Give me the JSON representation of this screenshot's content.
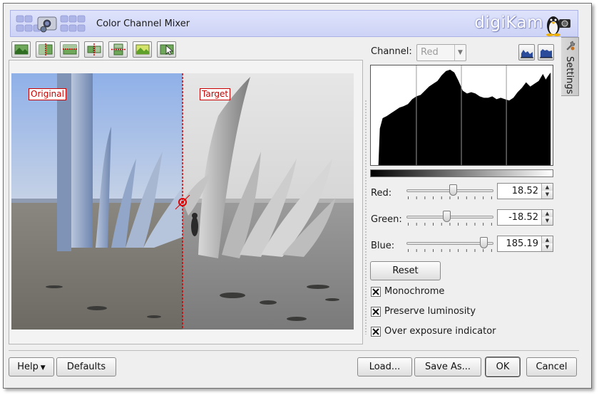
{
  "window": {
    "title": "Color Channel Mixer",
    "brand": "digiKam"
  },
  "toolbar": {
    "buttons": [
      "original-image-icon",
      "split-vertical-icon",
      "split-horizontal-icon",
      "separate-vertical-icon",
      "separate-horizontal-icon",
      "target-image-icon",
      "under-cursor-icon"
    ]
  },
  "preview": {
    "original_label": "Original",
    "target_label": "Target"
  },
  "channel": {
    "label": "Channel:",
    "selected": "Red"
  },
  "settings_tab": "Settings",
  "mixer": {
    "red": {
      "label": "Red:",
      "value": "18.52",
      "level": 0.54
    },
    "green": {
      "label": "Green:",
      "value": "-18.52",
      "level": 0.46
    },
    "blue": {
      "label": "Blue:",
      "value": "185.19",
      "level": 0.93
    }
  },
  "reset_button": "Reset",
  "options": [
    {
      "label": "Monochrome",
      "checked": true
    },
    {
      "label": "Preserve luminosity",
      "checked": true
    },
    {
      "label": "Over exposure indicator",
      "checked": true
    }
  ],
  "footer": {
    "help": "Help",
    "defaults": "Defaults",
    "load": "Load...",
    "save_as": "Save As...",
    "ok": "OK",
    "cancel": "Cancel"
  }
}
